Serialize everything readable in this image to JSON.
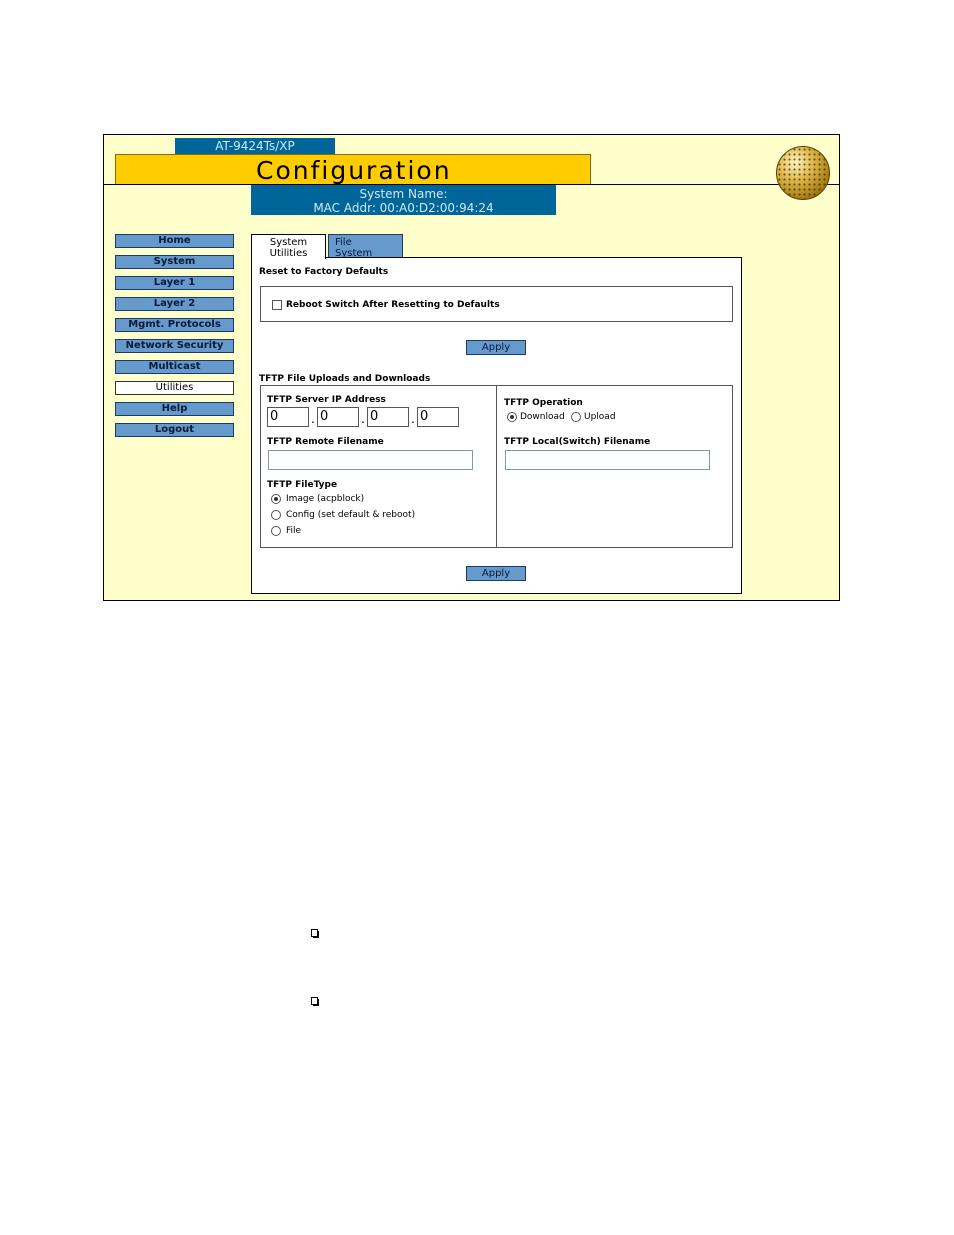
{
  "header": {
    "model": "AT-9424Ts/XP",
    "title": "Configuration",
    "system_name": "System Name:",
    "mac_addr": "MAC Addr: 00:A0:D2:00:94:24"
  },
  "nav": {
    "items": [
      {
        "label": "Home"
      },
      {
        "label": "System"
      },
      {
        "label": "Layer 1"
      },
      {
        "label": "Layer 2"
      },
      {
        "label": "Mgmt. Protocols"
      },
      {
        "label": "Network Security"
      },
      {
        "label": "Multicast"
      },
      {
        "label": "Utilities"
      },
      {
        "label": "Help"
      },
      {
        "label": "Logout"
      }
    ],
    "active": "Utilities"
  },
  "tabs": {
    "active_line1": "System",
    "active_line2": "Utilities",
    "inactive_line1": "File",
    "inactive_line2": "System"
  },
  "reset": {
    "heading": "Reset to Factory Defaults",
    "checkbox_label": "Reboot Switch After Resetting to Defaults",
    "apply_label": "Apply"
  },
  "tftp": {
    "heading": "TFTP File Uploads and Downloads",
    "server_ip_label": "TFTP Server IP Address",
    "ip": [
      "0",
      "0",
      "0",
      "0"
    ],
    "remote_filename_label": "TFTP Remote Filename",
    "filetype_label": "TFTP FileType",
    "filetype_options": [
      "Image (acpblock)",
      "Config (set default & reboot)",
      "File"
    ],
    "filetype_selected": "Image (acpblock)",
    "operation_label": "TFTP Operation",
    "operation_options": [
      "Download",
      "Upload"
    ],
    "operation_selected": "Download",
    "local_filename_label": "TFTP Local(Switch) Filename",
    "apply_label": "Apply"
  }
}
